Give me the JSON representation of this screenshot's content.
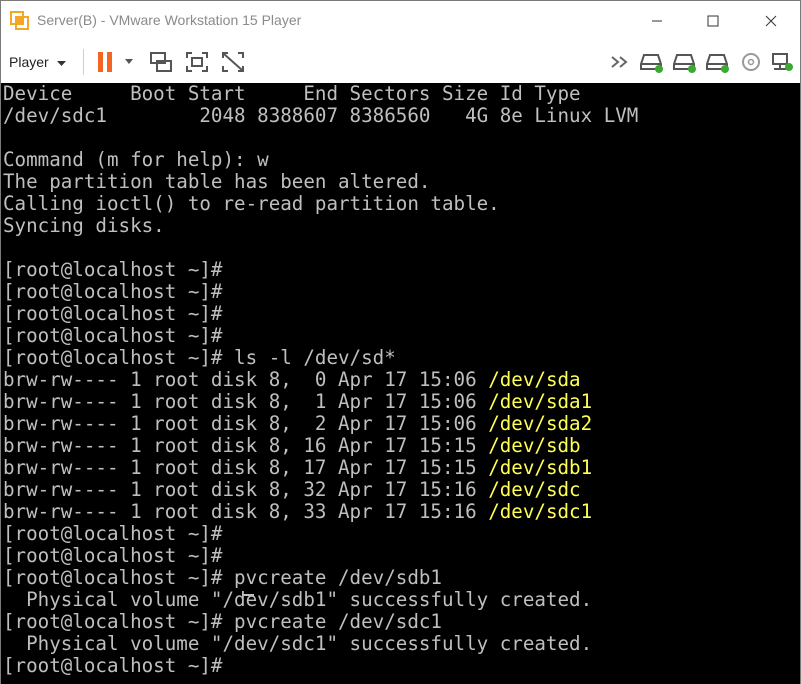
{
  "window": {
    "title": "Server(B) - VMware Workstation 15 Player"
  },
  "toolbar": {
    "player_label": "Player",
    "icons": [
      "pause-icon",
      "send-ctrl-alt-del-icon",
      "fit-guest-icon",
      "unity-icon",
      "more-devices-icon",
      "hard-disk-1-icon",
      "hard-disk-2-icon",
      "hard-disk-3-icon",
      "cd-dvd-icon",
      "network-icon"
    ]
  },
  "terminal": {
    "lines": [
      {
        "text": "Device     Boot Start     End Sectors Size Id Type"
      },
      {
        "text": "/dev/sdc1        2048 8388607 8386560   4G 8e Linux LVM"
      },
      {
        "text": ""
      },
      {
        "text": "Command (m for help): w"
      },
      {
        "text": "The partition table has been altered."
      },
      {
        "text": "Calling ioctl() to re-read partition table."
      },
      {
        "text": "Syncing disks."
      },
      {
        "text": ""
      },
      {
        "text": "[root@localhost ~]#"
      },
      {
        "text": "[root@localhost ~]#"
      },
      {
        "text": "[root@localhost ~]#"
      },
      {
        "text": "[root@localhost ~]#"
      },
      {
        "text": "[root@localhost ~]# ls -l /dev/sd*"
      },
      {
        "text": "brw-rw---- 1 root disk 8,  0 Apr 17 15:06 ",
        "highlight": "/dev/sda"
      },
      {
        "text": "brw-rw---- 1 root disk 8,  1 Apr 17 15:06 ",
        "highlight": "/dev/sda1"
      },
      {
        "text": "brw-rw---- 1 root disk 8,  2 Apr 17 15:06 ",
        "highlight": "/dev/sda2"
      },
      {
        "text": "brw-rw---- 1 root disk 8, 16 Apr 17 15:15 ",
        "highlight": "/dev/sdb"
      },
      {
        "text": "brw-rw---- 1 root disk 8, 17 Apr 17 15:15 ",
        "highlight": "/dev/sdb1"
      },
      {
        "text": "brw-rw---- 1 root disk 8, 32 Apr 17 15:16 ",
        "highlight": "/dev/sdc"
      },
      {
        "text": "brw-rw---- 1 root disk 8, 33 Apr 17 15:16 ",
        "highlight": "/dev/sdc1"
      },
      {
        "text": "[root@localhost ~]#"
      },
      {
        "text": "[root@localhost ~]#"
      },
      {
        "text": "[root@localhost ~]# pvcreate /dev/sdb1"
      },
      {
        "text": "  Physical volume \"/dev/sdb1\" successfully created."
      },
      {
        "text": "[root@localhost ~]# pvcreate /dev/sdc1"
      },
      {
        "text": "  Physical volume \"/dev/sdc1\" successfully created."
      },
      {
        "text": "[root@localhost ~]# "
      }
    ]
  },
  "colors": {
    "terminal_text": "#bfbfbf",
    "device_highlight": "#ffff55",
    "pause_accent": "#f26522"
  }
}
